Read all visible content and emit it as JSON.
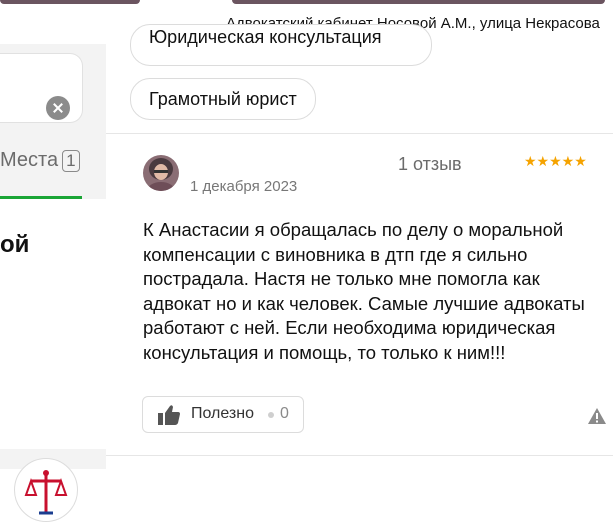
{
  "header": {
    "address": "Адвокатский кабинет Носовой А.М., улица Некрасова"
  },
  "sidebar": {
    "tab_label": "Места",
    "tab_count": "1",
    "title_fragment": "ой"
  },
  "tags": [
    "Юридическая консультация",
    "Грамотный юрист"
  ],
  "review": {
    "reviews_count": "1 отзыв",
    "date": "1 декабря 2023",
    "rating": 5,
    "stars": "★★★★★",
    "text": "К Анастасии я обращалась по делу о моральной компенсации с виновника в дтп где я сильно пострадала. Настя не только мне помогла как адвокат но и как человек. Самые лучшие адвокаты работают с ней. Если необходима юридическая консультация и помощь, то только к ним!!!",
    "useful_label": "Полезно",
    "useful_count": "0"
  },
  "colors": {
    "accent_green": "#1aa535",
    "star": "#f5a300"
  }
}
